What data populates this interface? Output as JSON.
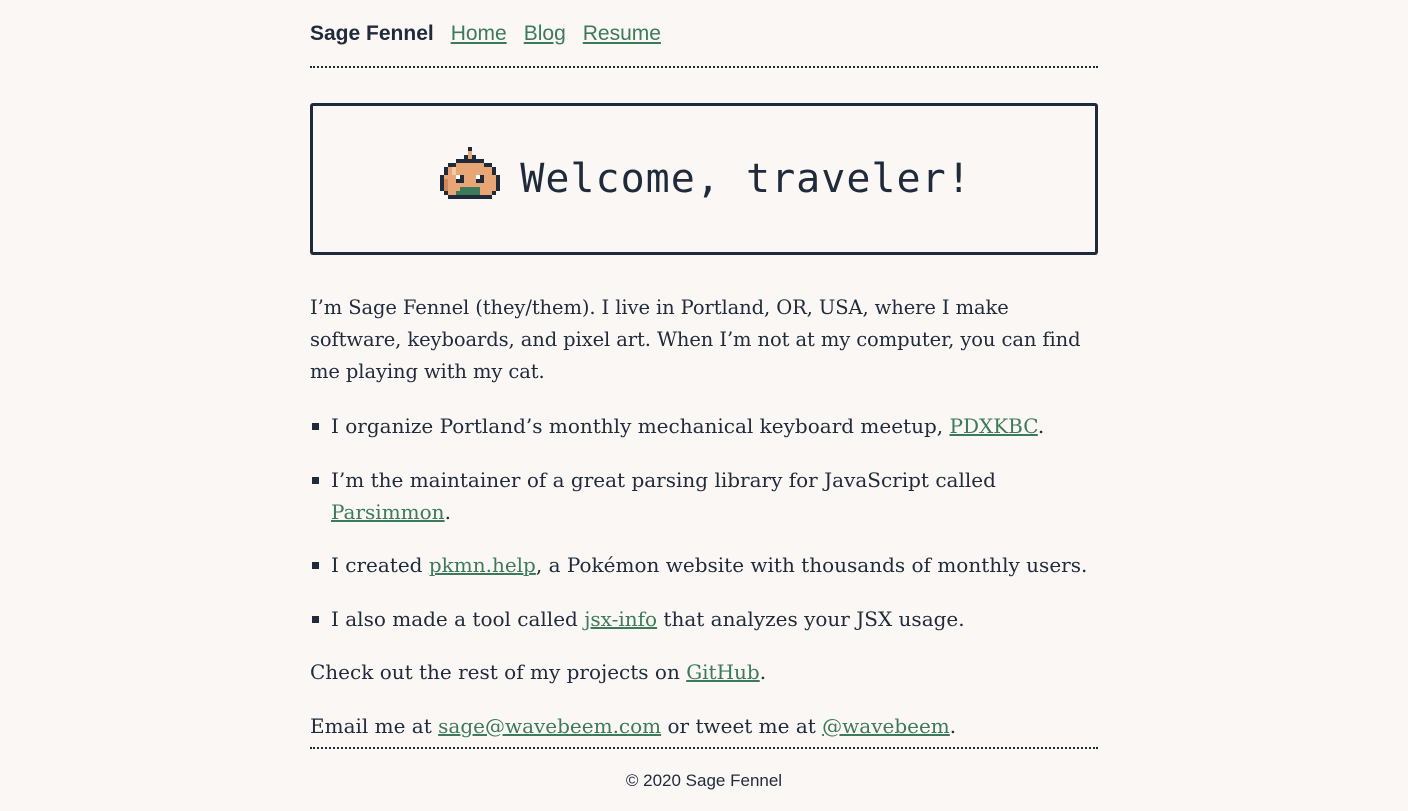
{
  "nav": {
    "site_name": "Sage Fennel",
    "links": [
      "Home",
      "Blog",
      "Resume"
    ]
  },
  "banner": {
    "icon": "onion-mascot-icon",
    "title": "Welcome, traveler!"
  },
  "intro": "I’m Sage Fennel (they/them). I live in Portland, OR, USA, where I make software, keyboards, and pixel art. When I’m not at my computer, you can find me playing with my cat.",
  "list": [
    {
      "before": "I organize Portland’s monthly mechanical keyboard meetup, ",
      "link": "PDXKBC",
      "after": "."
    },
    {
      "before": "I’m the maintainer of a great parsing library for JavaScript called ",
      "link": "Parsimmon",
      "after": "."
    },
    {
      "before": "I created ",
      "link": "pkmn.help",
      "after": ", a Pokémon website with thousands of monthly users."
    },
    {
      "before": "I also made a tool called ",
      "link": "jsx-info",
      "after": " that analyzes your JSX usage."
    }
  ],
  "projects": {
    "before": "Check out the rest of my projects on ",
    "link": "GitHub",
    "after": "."
  },
  "contact": {
    "before": "Email me at ",
    "email": "sage@wavebeem.com",
    "middle": " or tweet me at ",
    "twitter": "@wavebeem",
    "after": "."
  },
  "footer": "© 2020 Sage Fennel",
  "colors": {
    "background": "#fbf7f4",
    "text": "#1f2a3b",
    "link": "#3d7a5a",
    "mascot": "#e8a576"
  }
}
